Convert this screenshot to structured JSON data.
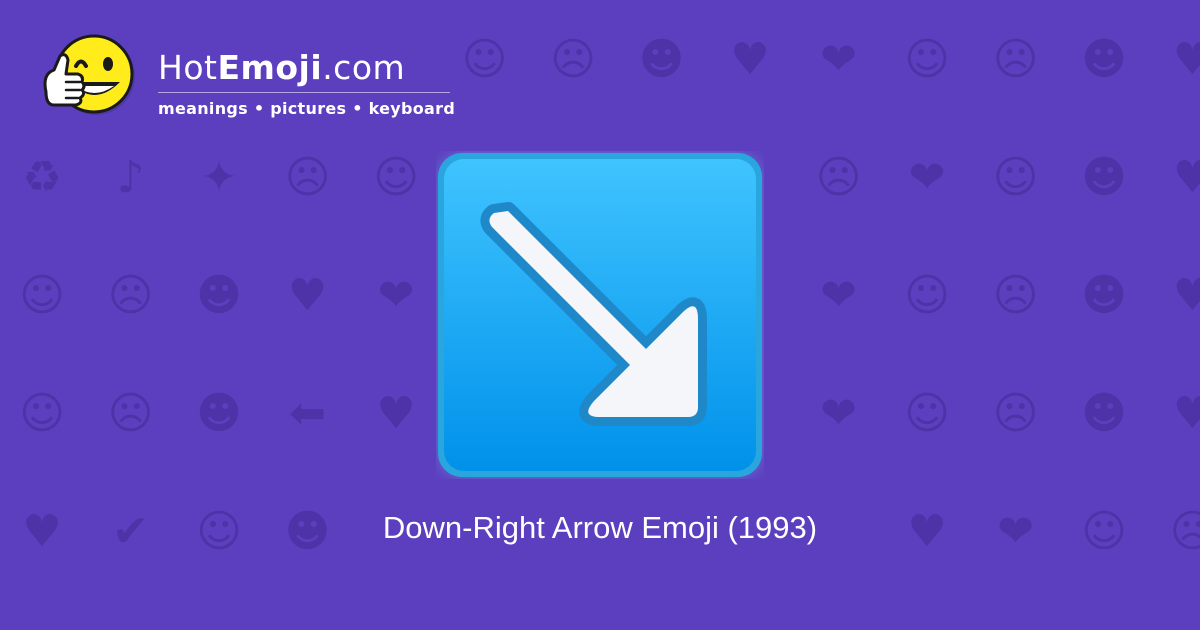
{
  "header": {
    "brand_prefix": "Hot",
    "brand_bold": "Emoji",
    "brand_suffix": ".com",
    "tagline": "meanings • pictures • keyboard"
  },
  "emoji": {
    "name": "down-right-arrow-emoji",
    "caption": "Down-Right Arrow Emoji (1993)"
  },
  "background_icons": [
    "☺",
    "☹",
    "☻",
    "♥",
    "❤",
    "☺",
    "☹",
    "☻",
    "♥",
    "❤",
    "☺",
    "☹",
    "☻",
    "♥",
    "❤",
    "☺",
    "☹",
    "☻",
    "♥",
    "❤",
    "♻",
    "♪",
    "✦",
    "☹",
    "☺",
    "♥",
    "☻",
    "☺",
    "♥",
    "☹",
    "❤",
    "☺",
    "☻",
    "♥",
    "☹",
    "☺",
    "❤",
    "☻",
    "☹",
    "♥",
    "☺",
    "☹",
    "☻",
    "♥",
    "❤",
    "☺",
    "☹",
    "☻",
    "♥",
    "❤",
    "☺",
    "☹",
    "☻",
    "♥",
    "❤",
    "☺",
    "☹",
    "☻",
    "♥",
    "❤",
    "☺",
    "☹",
    "☻",
    "⬅",
    "♥",
    "☺",
    "☹",
    "☻",
    "♥",
    "❤",
    "☺",
    "☹",
    "☻",
    "♥",
    "❤",
    "☀",
    "♥",
    "☺",
    "☹",
    "❤",
    "♥",
    "✔",
    "☺",
    "☻",
    "☹",
    "♥",
    "❤",
    "☺",
    "☹",
    "☻",
    "♥",
    "❤",
    "☺",
    "☹",
    "☻",
    "♥",
    "❤",
    "☺",
    "☹",
    "☻"
  ],
  "colors": {
    "background": "#5b3fbf",
    "pattern": "#4d33a7",
    "tile_blue_top": "#40c4ff",
    "tile_blue_bottom": "#0091ea",
    "arrow": "#f5f6f9"
  }
}
